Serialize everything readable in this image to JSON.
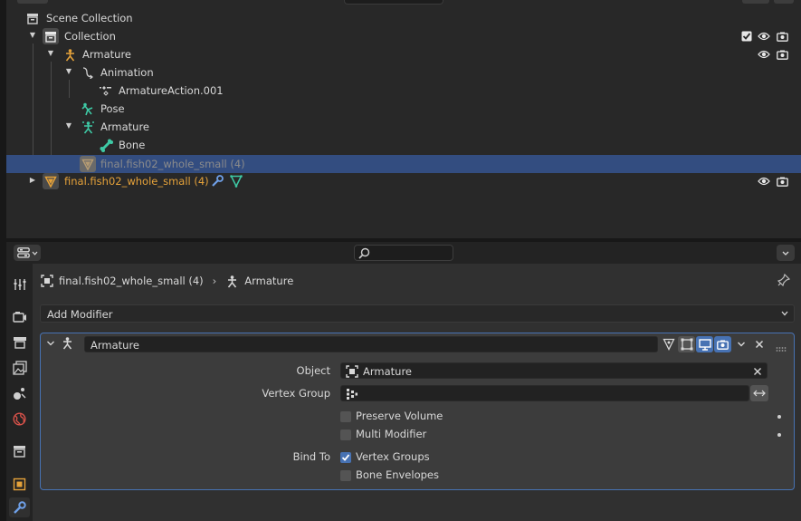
{
  "outliner": {
    "scene_collection": "Scene Collection",
    "collection": "Collection",
    "armature_object": "Armature",
    "animation": "Animation",
    "action": "ArmatureAction.001",
    "pose": "Pose",
    "armature_data": "Armature",
    "bone": "Bone",
    "child_mesh": "final.fish02_whole_small (4)",
    "mesh_object": "final.fish02_whole_small (4)"
  },
  "properties": {
    "breadcrumb_object": "final.fish02_whole_small (4)",
    "breadcrumb_modifier": "Armature",
    "add_modifier_label": "Add Modifier",
    "modifier": {
      "name": "Armature",
      "object_label": "Object",
      "object_value": "Armature",
      "vertex_group_label": "Vertex Group",
      "vertex_group_value": "",
      "preserve_volume_label": "Preserve Volume",
      "preserve_volume": false,
      "multi_modifier_label": "Multi Modifier",
      "multi_modifier": false,
      "bind_to_label": "Bind To",
      "vertex_groups_label": "Vertex Groups",
      "vertex_groups": true,
      "bone_envelopes_label": "Bone Envelopes",
      "bone_envelopes": false
    }
  },
  "colors": {
    "selection": "#334d80",
    "accent": "#4772b3",
    "object_orange": "#e5a23a",
    "data_green": "#3ec9a5"
  }
}
